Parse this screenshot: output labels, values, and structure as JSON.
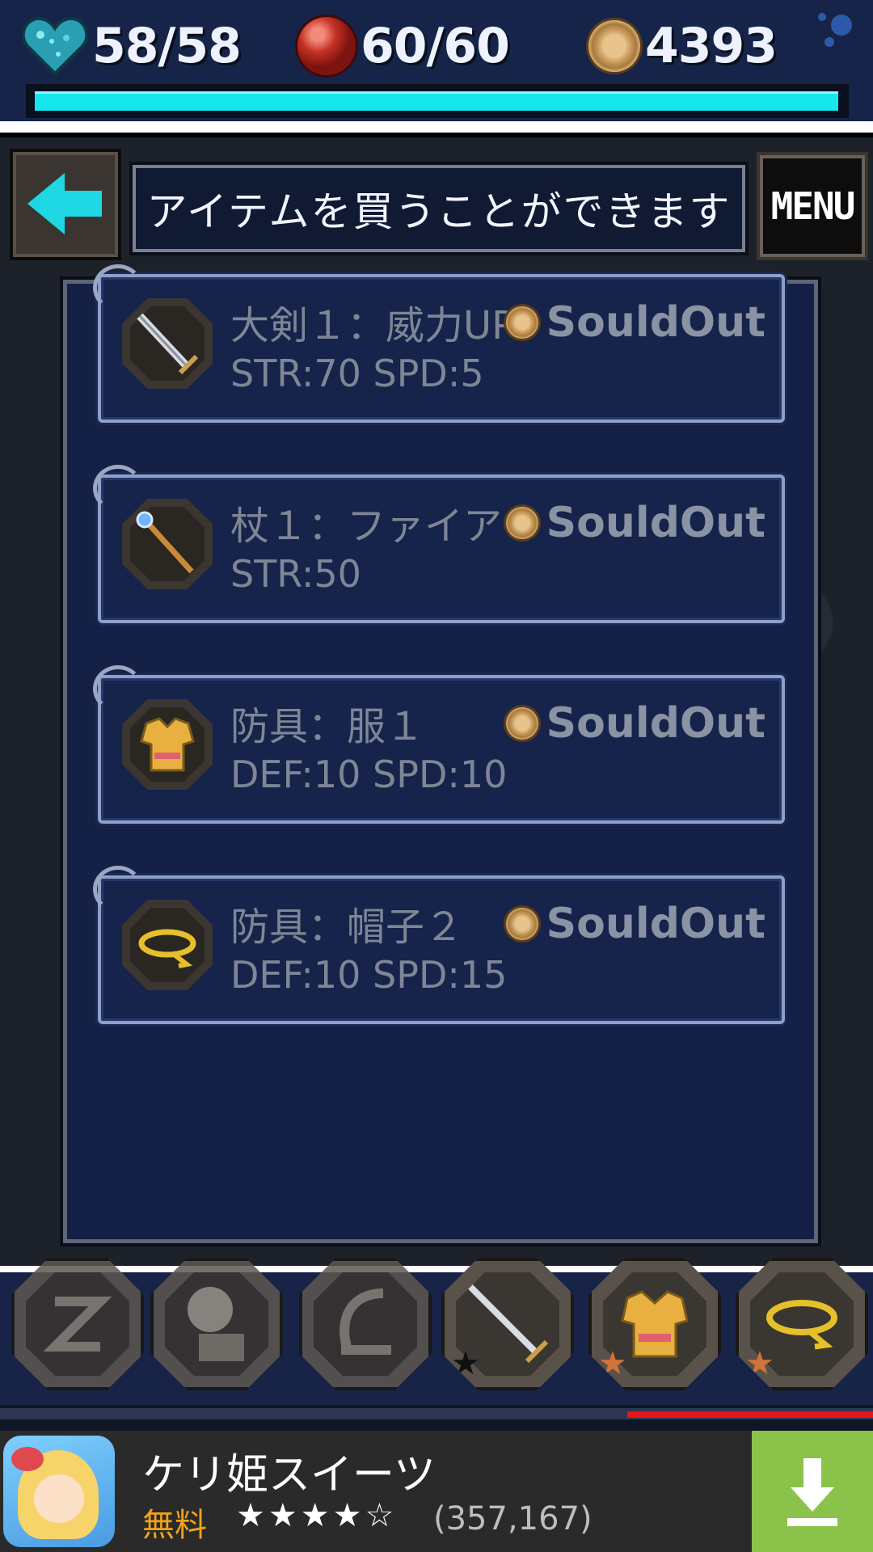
{
  "status": {
    "hp": "58/58",
    "mp": "60/60",
    "gold": "4393",
    "hp_bar_fraction": 1.0
  },
  "header": {
    "back_icon": "back-arrow-icon",
    "title": "アイテムを買うことができます",
    "menu_label": "MENU"
  },
  "shop": {
    "items": [
      {
        "name": "大剣１：威力UP",
        "stats": "STR:70  SPD:5",
        "price": "SouldOut",
        "icon": "greatsword-icon"
      },
      {
        "name": "杖１：ファイア",
        "stats": "STR:50",
        "price": "SouldOut",
        "icon": "staff-icon"
      },
      {
        "name": "防具：服１",
        "stats": "DEF:10  SPD:10",
        "price": "SouldOut",
        "icon": "clothes-icon"
      },
      {
        "name": "防具：帽子２",
        "stats": "DEF:10  SPD:15",
        "price": "SouldOut",
        "icon": "hat-icon"
      }
    ]
  },
  "equipment": {
    "slots": [
      {
        "icon": "locked-slot-icon"
      },
      {
        "icon": "locked-companion-icon"
      },
      {
        "icon": "locked-slot-icon"
      },
      {
        "icon": "sword-icon"
      },
      {
        "icon": "clothes-icon"
      },
      {
        "icon": "hat-icon"
      }
    ]
  },
  "ad": {
    "title": "ケリ姫スイーツ",
    "price": "無料",
    "stars": "★★★★☆",
    "reviews": "(357,167)",
    "download_icon": "download-icon"
  },
  "colors": {
    "hp_fill": "#16e6ee",
    "panel_bg": "#142045",
    "accent_red": "#e81418",
    "download_green": "#8bc34a",
    "free_orange": "#f2a21c"
  }
}
